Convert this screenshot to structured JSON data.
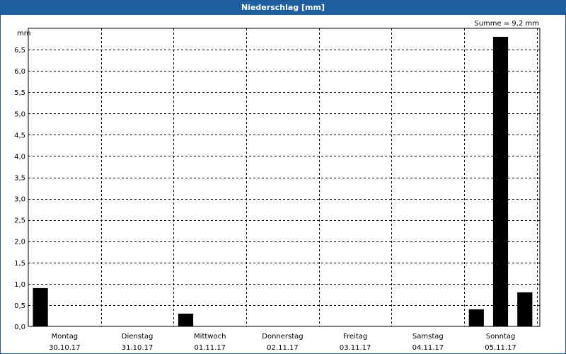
{
  "chart_data": {
    "type": "bar",
    "title": "Niederschlag [mm]",
    "ylabel": "mm",
    "annotation": "Summe = 9,2 mm",
    "ylim": [
      0,
      7
    ],
    "yticks": [
      0,
      0.5,
      1,
      1.5,
      2,
      2.5,
      3,
      3.5,
      4,
      4.5,
      5,
      5.5,
      6,
      6.5
    ],
    "ytick_labels": [
      "0,0",
      "0,5",
      "1,0",
      "1,5",
      "2,0",
      "2,5",
      "3,0",
      "3,5",
      "4,0",
      "4,5",
      "5,0",
      "5,5",
      "6,0",
      "6,5"
    ],
    "days": [
      {
        "name": "Montag",
        "date": "30.10.17"
      },
      {
        "name": "Dienstag",
        "date": "31.10.17"
      },
      {
        "name": "Mittwoch",
        "date": "01.11.17"
      },
      {
        "name": "Donnerstag",
        "date": "02.11.17"
      },
      {
        "name": "Freitag",
        "date": "03.11.17"
      },
      {
        "name": "Samstag",
        "date": "04.11.17"
      },
      {
        "name": "Sonntag",
        "date": "05.11.17"
      }
    ],
    "bars": [
      {
        "slot": 0,
        "value": 0.9
      },
      {
        "slot": 6,
        "value": 0.3
      },
      {
        "slot": 18,
        "value": 0.4
      },
      {
        "slot": 19,
        "value": 6.8
      },
      {
        "slot": 20,
        "value": 0.8
      }
    ],
    "slots_total": 21,
    "grid": true,
    "bar_color": "#000000",
    "grid_color": "#000000",
    "header_color": "#1f5f9f"
  }
}
